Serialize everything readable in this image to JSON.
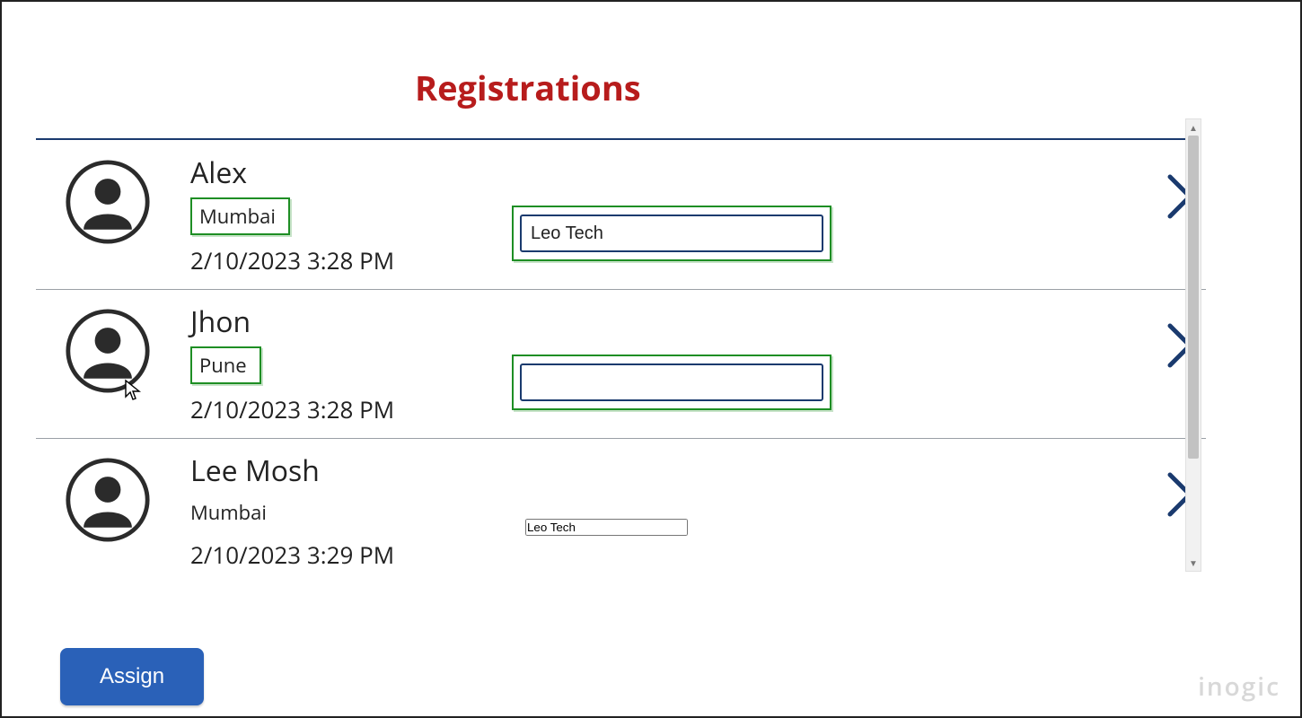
{
  "header": {
    "title": "Registrations"
  },
  "list": [
    {
      "name": "Alex",
      "city": "Mumbai",
      "city_highlighted": true,
      "timestamp": "2/10/2023 3:28 PM",
      "company": "Leo Tech",
      "company_highlighted": true
    },
    {
      "name": "Jhon",
      "city": "Pune",
      "city_highlighted": true,
      "timestamp": "2/10/2023 3:28 PM",
      "company": "",
      "company_highlighted": true
    },
    {
      "name": "Lee Mosh",
      "city": "Mumbai",
      "city_highlighted": false,
      "timestamp": "2/10/2023 3:29 PM",
      "company": "Leo Tech",
      "company_highlighted": false
    }
  ],
  "footer": {
    "assign_label": "Assign",
    "brand_watermark": "inogic"
  },
  "icons": {
    "avatar": "avatar-icon",
    "chevron": "chevron-right-icon",
    "cursor": "cursor-icon"
  }
}
